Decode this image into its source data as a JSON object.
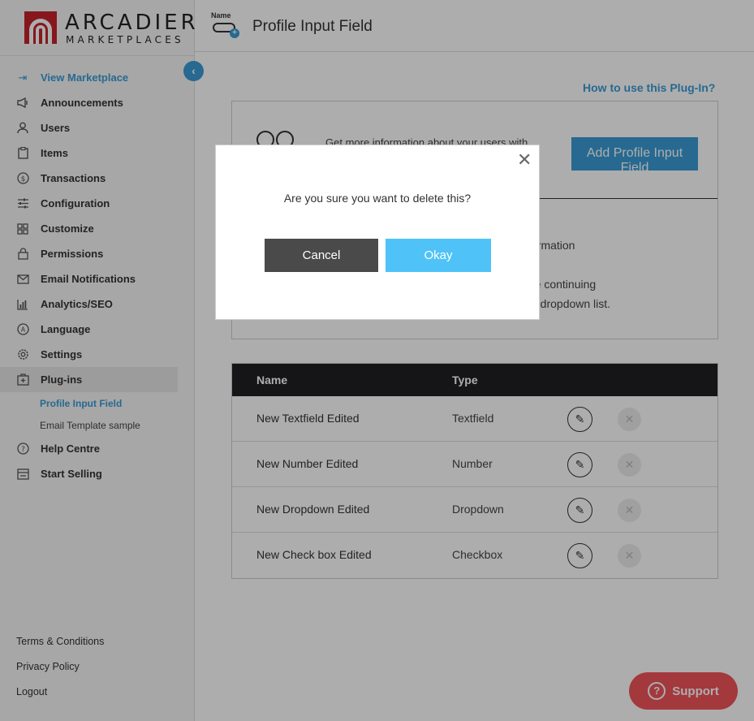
{
  "brand": {
    "name_line1": "ARCADIER",
    "name_line2": "MARKETPLACES"
  },
  "header": {
    "icon_tag": "Name",
    "title": "Profile Input Field"
  },
  "sidebar": {
    "collapse_icon": "‹",
    "items": [
      {
        "label": "View Marketplace",
        "icon": "enter-icon",
        "glyph": "⇥"
      },
      {
        "label": "Announcements",
        "icon": "megaphone-icon",
        "glyph": "📢"
      },
      {
        "label": "Users",
        "icon": "user-icon",
        "glyph": "☺"
      },
      {
        "label": "Items",
        "icon": "clipboard-icon",
        "glyph": "▢"
      },
      {
        "label": "Transactions",
        "icon": "dollar-icon",
        "glyph": "$"
      },
      {
        "label": "Configuration",
        "icon": "sliders-icon",
        "glyph": "≡"
      },
      {
        "label": "Customize",
        "icon": "grid-icon",
        "glyph": "⊞"
      },
      {
        "label": "Permissions",
        "icon": "lock-icon",
        "glyph": "🔒"
      },
      {
        "label": "Email Notifications",
        "icon": "mail-icon",
        "glyph": "✉"
      },
      {
        "label": "Analytics/SEO",
        "icon": "bar-chart-icon",
        "glyph": "▥"
      },
      {
        "label": "Language",
        "icon": "language-icon",
        "glyph": "Ⓐ"
      },
      {
        "label": "Settings",
        "icon": "gear-icon",
        "glyph": "⚙"
      },
      {
        "label": "Plug-ins",
        "icon": "plugin-icon",
        "glyph": "⊡"
      }
    ],
    "sub_items": [
      {
        "label": "Profile Input Field"
      },
      {
        "label": "Email Template sample"
      }
    ],
    "items_after": [
      {
        "label": "Help Centre",
        "icon": "help-icon",
        "glyph": "?"
      },
      {
        "label": "Start Selling",
        "icon": "store-icon",
        "glyph": "▤"
      }
    ],
    "footer": [
      {
        "label": "Terms & Conditions"
      },
      {
        "label": "Privacy Policy"
      },
      {
        "label": "Logout"
      }
    ]
  },
  "main": {
    "help_link": "How to use this Plug-In?",
    "info_text1": "Get more information about your users with",
    "add_button": "Add Profile Input Field",
    "info_text2": "ormation",
    "info_text3": "re continuing",
    "info_text4": "n dropdown list.",
    "table": {
      "headers": {
        "name": "Name",
        "type": "Type"
      },
      "rows": [
        {
          "name": "New Textfield Edited",
          "type": "Textfield"
        },
        {
          "name": "New Number Edited",
          "type": "Number"
        },
        {
          "name": "New Dropdown Edited",
          "type": "Dropdown"
        },
        {
          "name": "New Check box Edited",
          "type": "Checkbox"
        }
      ],
      "edit_glyph": "✎",
      "delete_glyph": "✕"
    }
  },
  "support": {
    "label": "Support",
    "glyph": "?"
  },
  "modal": {
    "close_glyph": "✕",
    "message": "Are you sure you want to delete this?",
    "cancel_label": "Cancel",
    "okay_label": "Okay"
  },
  "colors": {
    "accent": "#3a9bd5",
    "okay": "#4fc3f7",
    "cancel": "#4a4a4a",
    "support": "#f0555a",
    "brand_red": "#c5232c"
  }
}
